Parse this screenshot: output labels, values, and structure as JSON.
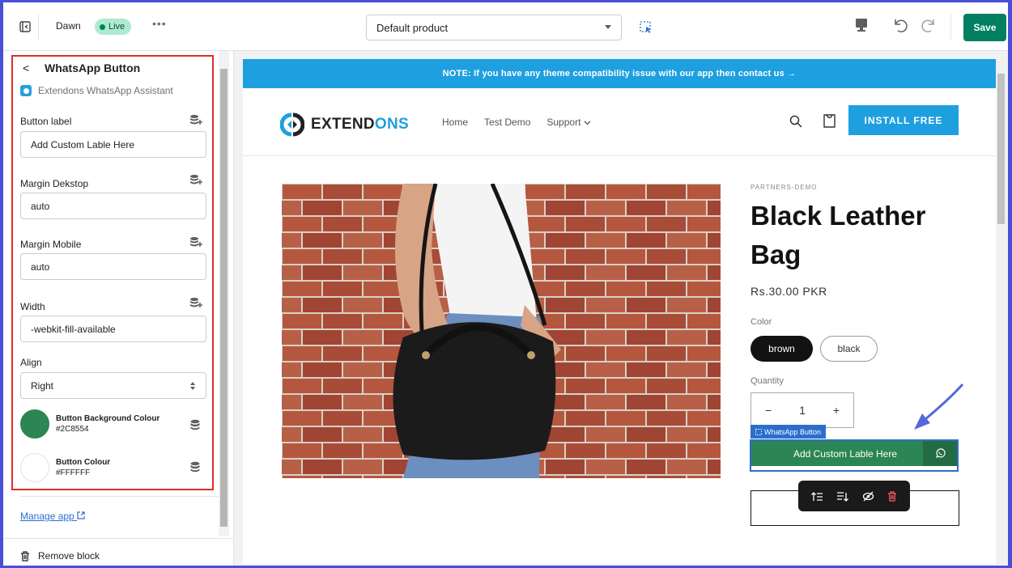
{
  "topbar": {
    "theme_name": "Dawn",
    "live_badge": "Live",
    "more_label": "•••",
    "template_select": "Default product",
    "save_label": "Save"
  },
  "sidebar": {
    "back_label": "<",
    "title": "WhatsApp Button",
    "app_name": "Extendons WhatsApp Assistant",
    "fields": {
      "button_label": {
        "label": "Button label",
        "value": "Add Custom Lable Here"
      },
      "margin_desktop": {
        "label": "Margin Dekstop",
        "value": "auto"
      },
      "margin_mobile": {
        "label": "Margin Mobile",
        "value": "auto"
      },
      "width": {
        "label": "Width",
        "value": "-webkit-fill-available"
      },
      "align": {
        "label": "Align",
        "value": "Right"
      }
    },
    "colors": {
      "bg": {
        "label": "Button Background Colour",
        "hex": "#2C8554",
        "swatch": "#2C8554"
      },
      "fg": {
        "label": "Button Colour",
        "hex": "#FFFFFF",
        "swatch": "#FFFFFF"
      }
    },
    "manage_app": "Manage app",
    "remove_block": "Remove block"
  },
  "preview": {
    "announcement": "NOTE: If you have any theme compatibility issue with our app then contact us  →",
    "logo_prefix": "EXTEND",
    "logo_accent": "ONS",
    "nav": [
      "Home",
      "Test Demo",
      "Support"
    ],
    "install_label": "INSTALL FREE",
    "vendor": "PARTNERS-DEMO",
    "product_title": "Black Leather Bag",
    "price": "Rs.30.00 PKR",
    "color_label": "Color",
    "variants": [
      "brown",
      "black"
    ],
    "quantity_label": "Quantity",
    "quantity_minus": "−",
    "quantity": "1",
    "quantity_plus": "+",
    "block_tag": "WhatsApp Button",
    "whatsapp_label": "Add Custom Lable Here",
    "brand_color": "#1E9FE0"
  }
}
